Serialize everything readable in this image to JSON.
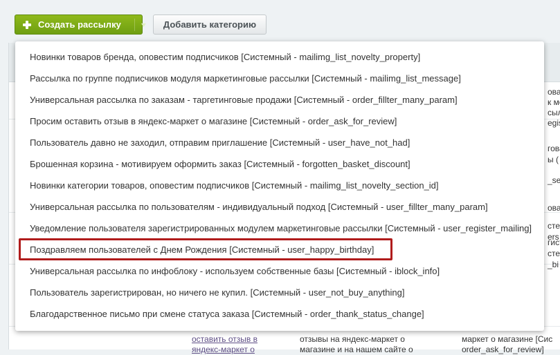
{
  "toolbar": {
    "create_button": "Создать рассылку",
    "add_category_button": "Добавить категорию"
  },
  "dropdown": {
    "items": [
      "Новинки товаров бренда, оповестим подписчиков [Системный - mailimg_list_novelty_property]",
      "Рассылка по группе подписчиков модуля маркетинговые рассылки [Системный - mailimg_list_message]",
      "Универсальная рассылка по заказам - таргетинговые продажи [Системный - order_fillter_many_param]",
      "Просим оставить отзыв в яндекс-маркет о магазине [Системный - order_ask_for_review]",
      "Пользователь давно не заходил, отправим приглашение [Системный - user_have_not_had]",
      "Брошенная корзина - мотивируем оформить заказ [Системный - forgotten_basket_discount]",
      "Новинки категории товаров, оповестим подписчиков [Системный - mailimg_list_novelty_section_id]",
      "Универсальная рассылка по пользователям - индивидуальный подход [Системный - user_fillter_many_param]",
      "Уведомление пользователя зарегистрированных модулем маркетинговые рассылки [Системный - user_register_mailing]",
      "Поздравляем пользователей с Днем Рождения [Системный - user_happy_birthday]",
      "Универсальная рассылка по инфоблоку - используем собственные базы [Системный - iblock_info]",
      "Пользователь зарегистрирован, но ничего не купил. [Системный - user_not_buy_anything]",
      "Благодарственное письмо при смене статуса заказа [Системный - order_thank_status_change]"
    ]
  },
  "background": {
    "right_fragments": [
      "ова",
      "к мо",
      "сыл",
      "egis",
      "гова",
      "ы (",
      "_se",
      "ова",
      "сте",
      "ers",
      "гист",
      "сте",
      "_bi"
    ],
    "bottom_col1": [
      "оставить отзыв в",
      "яндекс-маркет о"
    ],
    "bottom_col2": [
      "отзывы на яндекс-маркет о",
      "магазине и на нашем сайте о"
    ],
    "bottom_col3": [
      "маркет о магазине [Сис",
      "order_ask_for_review]"
    ]
  },
  "colors": {
    "create_green": "#7aab16",
    "highlight_red": "#b01c1c"
  }
}
